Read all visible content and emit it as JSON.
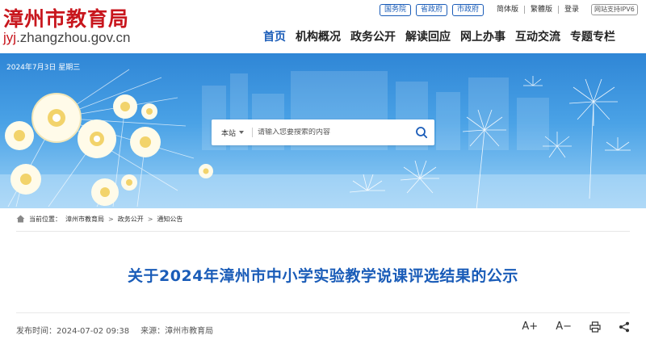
{
  "header": {
    "site_name": "漳州市教育局",
    "url_highlight": "jyj",
    "url_rest": ".zhangzhou.gov.cn",
    "top_links": [
      "国务院",
      "省政府",
      "市政府"
    ],
    "simplified": "简体版",
    "traditional": "繁體版",
    "login": "登录",
    "ipv6": "网站支持IPV6"
  },
  "nav": {
    "items": [
      "首页",
      "机构概况",
      "政务公开",
      "解读回应",
      "网上办事",
      "互动交流",
      "专题专栏"
    ],
    "active_index": 0
  },
  "banner": {
    "date": "2024年7月3日 星期三",
    "search": {
      "scope": "本站",
      "placeholder": "请输入您要搜索的内容"
    }
  },
  "breadcrumb": {
    "label": "当前位置：",
    "items": [
      "漳州市教育局",
      "政务公开",
      "通知公告"
    ],
    "separator": ">"
  },
  "article": {
    "title": "关于2024年漳州市中小学实验教学说课评选结果的公示",
    "publish_time": "发布时间：2024-07-02 09:38",
    "source": "来源：漳州市教育局",
    "font_increase": "A+",
    "font_decrease": "A−"
  },
  "colors": {
    "brand_red": "#c8161d",
    "brand_blue": "#1a5cb8"
  }
}
